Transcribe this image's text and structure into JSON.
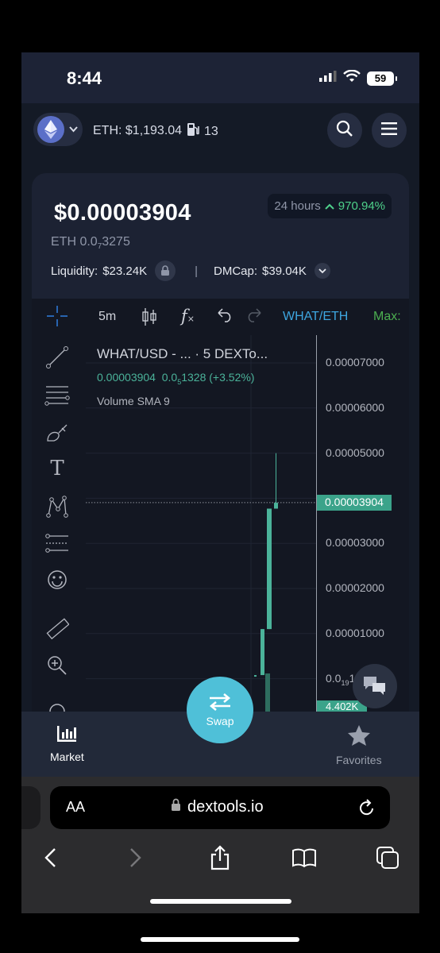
{
  "status_bar": {
    "time": "8:44",
    "battery": "59"
  },
  "header": {
    "eth_price": "ETH: $1,193.04",
    "gas": "13",
    "chain_icon": "ethereum-icon"
  },
  "token": {
    "price_usd": "$0.00003904",
    "eth_prefix": "ETH 0.0",
    "eth_sub": "7",
    "eth_suffix": "3275",
    "change_label": "24 hours",
    "change_value": "970.94%",
    "liquidity_label": "Liquidity:",
    "liquidity_value": "$23.24K",
    "dmcap_label": "DMCap:",
    "dmcap_value": "$39.04K"
  },
  "chart_toolbar": {
    "timeframe": "5m",
    "fx": "f",
    "pair_tab": "WHAT/ETH",
    "max_tab": "Max:"
  },
  "chart_legend": {
    "title": "WHAT/USD - ...  · 5  DEXTo...",
    "ohlc_price": "0.00003904",
    "ohlc_change_prefix": "0.0",
    "ohlc_change_sub": "5",
    "ohlc_change_suffix": "1328 (+3.52%)",
    "volume": "Volume SMA 9"
  },
  "chart_data": {
    "type": "candlestick",
    "y_ticks": [
      "0.00007000",
      "0.00006000",
      "0.00005000",
      "0.00003000",
      "0.00002000",
      "0.00001000"
    ],
    "y_tick_partial": {
      "prefix": "0.0",
      "sub": "19",
      "suffix": "1"
    },
    "ylim": [
      0,
      7.5e-05
    ],
    "last_price_label": "0.00003904",
    "volume_label": "4.402K",
    "candles": [
      {
        "open": 8e-07,
        "high": 8e-07,
        "low": 8e-07,
        "close": 8e-07
      },
      {
        "open": 8e-07,
        "high": 1.1e-05,
        "low": 8e-07,
        "close": 1.1e-05
      },
      {
        "open": 1.1e-05,
        "high": 3.77e-05,
        "low": 1.1e-05,
        "close": 3.77e-05
      },
      {
        "open": 3.77e-05,
        "high": 5e-05,
        "low": 3.77e-05,
        "close": 3.9e-05
      }
    ]
  },
  "bottom_nav": {
    "market": "Market",
    "favorites": "Favorites",
    "swap": "Swap"
  },
  "browser": {
    "aa": "AA",
    "url": "dextools.io"
  }
}
